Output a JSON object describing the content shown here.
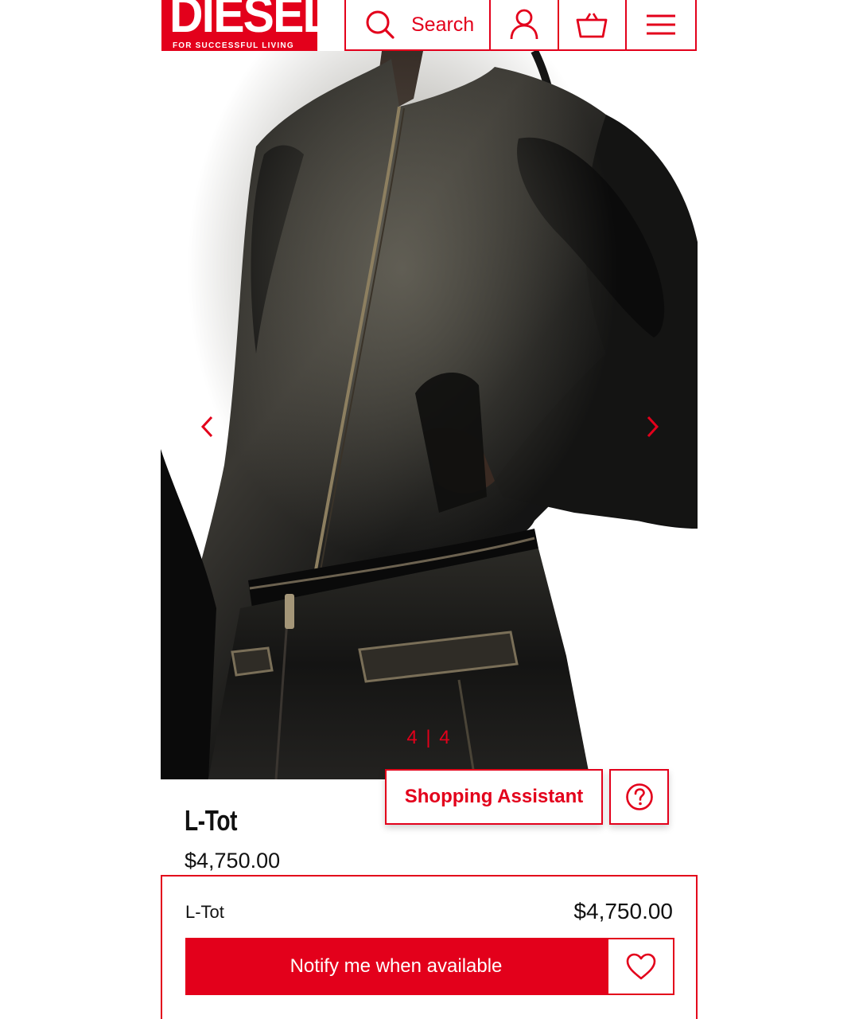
{
  "brand": {
    "logo_text": "DIESEL",
    "tagline": "FOR SUCCESSFUL LIVING",
    "accent_color": "#e3001b"
  },
  "header": {
    "search_label": "Search",
    "icons": [
      "search-icon",
      "account-icon",
      "basket-icon",
      "menu-icon"
    ]
  },
  "gallery": {
    "current_image": 4,
    "total_images": 4,
    "counter_text": "4 | 4",
    "icons": [
      "chevron-left-icon",
      "chevron-right-icon"
    ]
  },
  "assistant": {
    "label": "Shopping Assistant",
    "help_icon": "question-circle-icon"
  },
  "product": {
    "name": "L-Tot",
    "price": "$4,750.00"
  },
  "sticky_bar": {
    "name": "L-Tot",
    "price": "$4,750.00",
    "notify_label": "Notify me when available",
    "wishlist_icon": "heart-icon"
  }
}
